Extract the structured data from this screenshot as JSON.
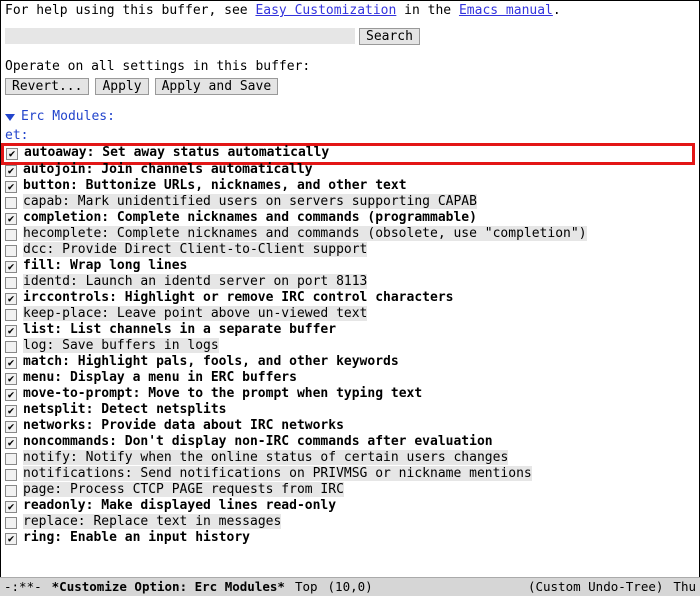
{
  "help": {
    "prefix": "For help using this buffer, see ",
    "link1": "Easy Customization",
    "mid": " in the ",
    "link2": "Emacs manual",
    "suffix": "."
  },
  "search": {
    "placeholder": "",
    "button": "Search"
  },
  "operate_label": "Operate on all settings in this buffer:",
  "buttons": {
    "revert": "Revert...",
    "apply": "Apply",
    "apply_save": "Apply and Save"
  },
  "section": {
    "title": "Erc Modules:",
    "truncated_top": "et:"
  },
  "modules": [
    {
      "checked": true,
      "name": "autoaway",
      "desc": "Set away status automatically",
      "highlight": true
    },
    {
      "checked": true,
      "name": "autojoin",
      "desc": "Join channels automatically"
    },
    {
      "checked": true,
      "name": "button",
      "desc": "Buttonize URLs, nicknames, and other text"
    },
    {
      "checked": false,
      "name": "capab",
      "desc": "Mark unidentified users on servers supporting CAPAB"
    },
    {
      "checked": true,
      "name": "completion",
      "desc": "Complete nicknames and commands (programmable)"
    },
    {
      "checked": false,
      "name": "hecomplete",
      "desc": "Complete nicknames and commands (obsolete, use \"completion\")"
    },
    {
      "checked": false,
      "name": "dcc",
      "desc": "Provide Direct Client-to-Client support"
    },
    {
      "checked": true,
      "name": "fill",
      "desc": "Wrap long lines"
    },
    {
      "checked": false,
      "name": "identd",
      "desc": "Launch an identd server on port 8113"
    },
    {
      "checked": true,
      "name": "irccontrols",
      "desc": "Highlight or remove IRC control characters"
    },
    {
      "checked": false,
      "name": "keep-place",
      "desc": "Leave point above un-viewed text"
    },
    {
      "checked": true,
      "name": "list",
      "desc": "List channels in a separate buffer"
    },
    {
      "checked": false,
      "name": "log",
      "desc": "Save buffers in logs"
    },
    {
      "checked": true,
      "name": "match",
      "desc": "Highlight pals, fools, and other keywords"
    },
    {
      "checked": true,
      "name": "menu",
      "desc": "Display a menu in ERC buffers"
    },
    {
      "checked": true,
      "name": "move-to-prompt",
      "desc": "Move to the prompt when typing text"
    },
    {
      "checked": true,
      "name": "netsplit",
      "desc": "Detect netsplits"
    },
    {
      "checked": true,
      "name": "networks",
      "desc": "Provide data about IRC networks"
    },
    {
      "checked": true,
      "name": "noncommands",
      "desc": "Don't display non-IRC commands after evaluation"
    },
    {
      "checked": false,
      "name": "notify",
      "desc": "Notify when the online status of certain users changes"
    },
    {
      "checked": false,
      "name": "notifications",
      "desc": "Send notifications on PRIVMSG or nickname mentions"
    },
    {
      "checked": false,
      "name": "page",
      "desc": "Process CTCP PAGE requests from IRC"
    },
    {
      "checked": true,
      "name": "readonly",
      "desc": "Make displayed lines read-only"
    },
    {
      "checked": false,
      "name": "replace",
      "desc": "Replace text in messages"
    },
    {
      "checked": true,
      "name": "ring",
      "desc": "Enable an input history"
    }
  ],
  "modeline": {
    "status": "-:**-",
    "buffer": "*Customize Option: Erc Modules*",
    "pos": "Top",
    "coords": "(10,0)",
    "mode": "(Custom Undo-Tree)",
    "day": "Thu"
  }
}
